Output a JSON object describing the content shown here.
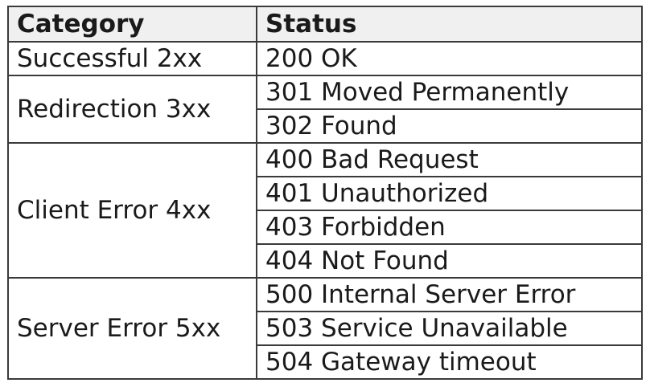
{
  "table": {
    "headers": {
      "category": "Category",
      "status": "Status"
    },
    "groups": [
      {
        "category": "Successful 2xx",
        "statuses": [
          "200 OK"
        ]
      },
      {
        "category": "Redirection 3xx",
        "statuses": [
          "301 Moved Permanently",
          "302 Found"
        ]
      },
      {
        "category": "Client Error 4xx",
        "statuses": [
          "400 Bad Request",
          "401 Unauthorized",
          "403 Forbidden",
          "404 Not Found"
        ]
      },
      {
        "category": "Server Error 5xx",
        "statuses": [
          "500 Internal Server Error",
          "503 Service Unavailable",
          "504 Gateway timeout"
        ]
      }
    ]
  }
}
